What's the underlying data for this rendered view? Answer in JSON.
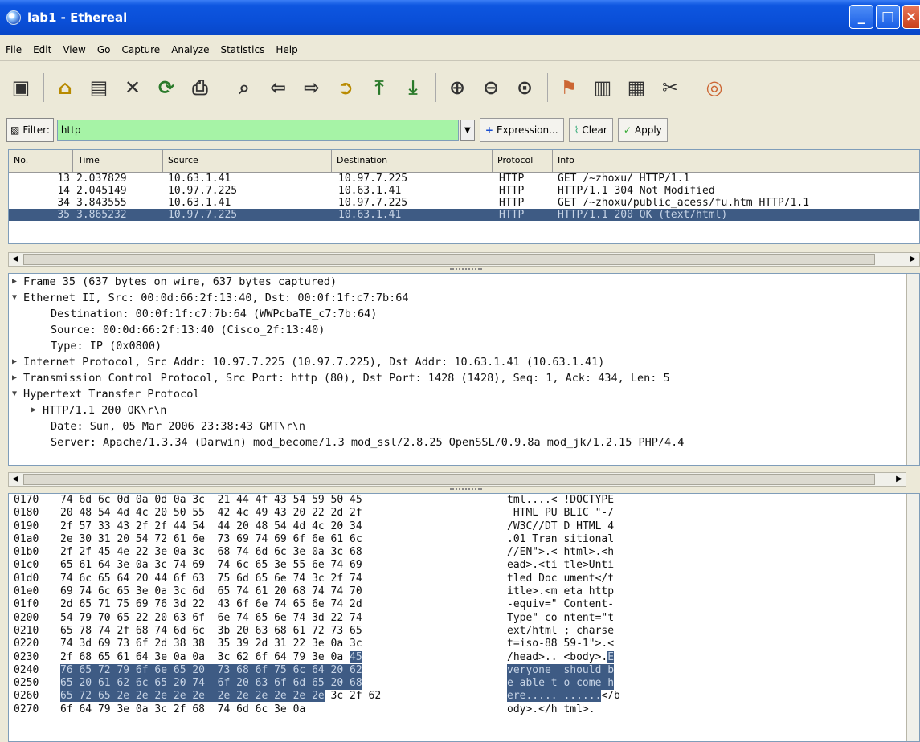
{
  "window": {
    "title": "lab1 - Ethereal"
  },
  "menu": [
    "File",
    "Edit",
    "View",
    "Go",
    "Capture",
    "Analyze",
    "Statistics",
    "Help"
  ],
  "filter": {
    "label": "Filter:",
    "value": "http",
    "expression_label": "Expression...",
    "clear_label": "Clear",
    "apply_label": "Apply"
  },
  "packet_list": {
    "columns": [
      "No.",
      "Time",
      "Source",
      "Destination",
      "Protocol",
      "Info"
    ],
    "rows": [
      {
        "no": "13",
        "time": "2.037829",
        "source": "10.63.1.41",
        "destination": "10.97.7.225",
        "protocol": "HTTP",
        "info": "GET /~zhoxu/ HTTP/1.1"
      },
      {
        "no": "14",
        "time": "2.045149",
        "source": "10.97.7.225",
        "destination": "10.63.1.41",
        "protocol": "HTTP",
        "info": "HTTP/1.1 304 Not Modified"
      },
      {
        "no": "34",
        "time": "3.843555",
        "source": "10.63.1.41",
        "destination": "10.97.7.225",
        "protocol": "HTTP",
        "info": "GET /~zhoxu/public_acess/fu.htm HTTP/1.1"
      },
      {
        "no": "35",
        "time": "3.865232",
        "source": "10.97.7.225",
        "destination": "10.63.1.41",
        "protocol": "HTTP",
        "info": "HTTP/1.1 200 OK (text/html)"
      }
    ]
  },
  "details": [
    "Frame 35 (637 bytes on wire, 637 bytes captured)",
    "Ethernet II, Src: 00:0d:66:2f:13:40, Dst: 00:0f:1f:c7:7b:64",
    "Destination: 00:0f:1f:c7:7b:64 (WWPcbaTE_c7:7b:64)",
    "Source: 00:0d:66:2f:13:40 (Cisco_2f:13:40)",
    "Type: IP (0x0800)",
    "Internet Protocol, Src Addr: 10.97.7.225 (10.97.7.225), Dst Addr: 10.63.1.41 (10.63.1.41)",
    "Transmission Control Protocol, Src Port: http (80), Dst Port: 1428 (1428), Seq: 1, Ack: 434, Len: 5",
    "Hypertext Transfer Protocol",
    "HTTP/1.1 200 OK\\r\\n",
    "Date: Sun, 05 Mar 2006 23:38:43 GMT\\r\\n",
    "Server: Apache/1.3.34 (Darwin) mod_become/1.3 mod_ssl/2.8.25 OpenSSL/0.9.8a mod_jk/1.2.15 PHP/4.4"
  ],
  "bytes": [
    {
      "off": "0170",
      "hex": "74 6d 6c 0d 0a 0d 0a 3c  21 44 4f 43 54 59 50 45",
      "ascii": "tml....< !DOCTYPE"
    },
    {
      "off": "0180",
      "hex": "20 48 54 4d 4c 20 50 55  42 4c 49 43 20 22 2d 2f",
      "ascii": " HTML PU BLIC \"-/"
    },
    {
      "off": "0190",
      "hex": "2f 57 33 43 2f 2f 44 54  44 20 48 54 4d 4c 20 34",
      "ascii": "/W3C//DT D HTML 4"
    },
    {
      "off": "01a0",
      "hex": "2e 30 31 20 54 72 61 6e  73 69 74 69 6f 6e 61 6c",
      "ascii": ".01 Tran sitional"
    },
    {
      "off": "01b0",
      "hex": "2f 2f 45 4e 22 3e 0a 3c  68 74 6d 6c 3e 0a 3c 68",
      "ascii": "//EN\">.< html>.<h"
    },
    {
      "off": "01c0",
      "hex": "65 61 64 3e 0a 3c 74 69  74 6c 65 3e 55 6e 74 69",
      "ascii": "ead>.<ti tle>Unti"
    },
    {
      "off": "01d0",
      "hex": "74 6c 65 64 20 44 6f 63  75 6d 65 6e 74 3c 2f 74",
      "ascii": "tled Doc ument</t"
    },
    {
      "off": "01e0",
      "hex": "69 74 6c 65 3e 0a 3c 6d  65 74 61 20 68 74 74 70",
      "ascii": "itle>.<m eta http"
    },
    {
      "off": "01f0",
      "hex": "2d 65 71 75 69 76 3d 22  43 6f 6e 74 65 6e 74 2d",
      "ascii": "-equiv=\" Content-"
    },
    {
      "off": "0200",
      "hex": "54 79 70 65 22 20 63 6f  6e 74 65 6e 74 3d 22 74",
      "ascii": "Type\" co ntent=\"t"
    },
    {
      "off": "0210",
      "hex": "65 78 74 2f 68 74 6d 6c  3b 20 63 68 61 72 73 65",
      "ascii": "ext/html ; charse"
    },
    {
      "off": "0220",
      "hex": "74 3d 69 73 6f 2d 38 38  35 39 2d 31 22 3e 0a 3c",
      "ascii": "t=iso-88 59-1\">.<"
    },
    {
      "off": "0230",
      "hex": "2f 68 65 61 64 3e 0a 0a  3c 62 6f 64 79 3e 0a ",
      "hexhl": "45",
      "ascii": "/head>.. <body>.",
      "asciihl": "E"
    },
    {
      "off": "0240",
      "hexhl": "76 65 72 79 6f 6e 65 20  73 68 6f 75 6c 64 20 62",
      "asciihl": "veryone  should b"
    },
    {
      "off": "0250",
      "hexhl": "65 20 61 62 6c 65 20 74  6f 20 63 6f 6d 65 20 68",
      "asciihl": "e able t o come h"
    },
    {
      "off": "0260",
      "hexhl": "65 72 65 2e 2e 2e 2e 2e  2e 2e 2e 2e 2e 2e",
      "hex": " 3c 2f 62",
      "asciihl": "ere..... ......",
      "ascii": "</b"
    },
    {
      "off": "0270",
      "hex": "6f 64 79 3e 0a 3c 2f 68  74 6d 6c 3e 0a",
      "ascii": "ody>.</h tml>."
    }
  ]
}
